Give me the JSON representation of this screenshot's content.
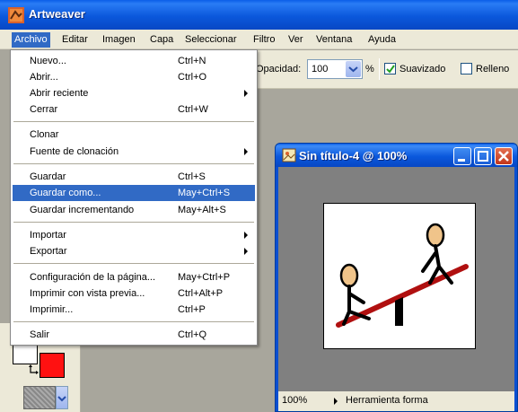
{
  "app": {
    "title": "Artweaver"
  },
  "menubar": {
    "items": [
      "Archivo",
      "Editar",
      "Imagen",
      "Capa",
      "Seleccionar",
      "Filtro",
      "Ver",
      "Ventana",
      "Ayuda"
    ],
    "active": "Archivo"
  },
  "options": {
    "opacity_label": "Opacidad:",
    "opacity_value": "100",
    "percent": "%",
    "smoothing_label": "Suavizado",
    "smoothing_checked": true,
    "fill_label": "Relleno",
    "fill_checked": false
  },
  "file_menu": [
    {
      "label": "Nuevo...",
      "shortcut": "Ctrl+N"
    },
    {
      "label": "Abrir...",
      "shortcut": "Ctrl+O"
    },
    {
      "label": "Abrir reciente",
      "shortcut": "",
      "submenu": true
    },
    {
      "label": "Cerrar",
      "shortcut": "Ctrl+W"
    },
    {
      "label": "Clonar",
      "shortcut": ""
    },
    {
      "label": "Fuente de clonación",
      "shortcut": "",
      "submenu": true
    },
    {
      "label": "Guardar",
      "shortcut": "Ctrl+S"
    },
    {
      "label": "Guardar como...",
      "shortcut": "May+Ctrl+S",
      "highlighted": true
    },
    {
      "label": "Guardar incrementando",
      "shortcut": "May+Alt+S"
    },
    {
      "label": "Importar",
      "shortcut": "",
      "submenu": true
    },
    {
      "label": "Exportar",
      "shortcut": "",
      "submenu": true
    },
    {
      "label": "Configuración de la página...",
      "shortcut": "May+Ctrl+P"
    },
    {
      "label": "Imprimir con vista previa...",
      "shortcut": "Ctrl+Alt+P"
    },
    {
      "label": "Imprimir...",
      "shortcut": "Ctrl+P"
    },
    {
      "label": "Salir",
      "shortcut": "Ctrl+Q"
    }
  ],
  "document": {
    "title": "Sin título-4 @ 100%",
    "zoom": "100%",
    "tool": "Herramienta forma"
  },
  "colors": {
    "foreground": "#ffffff",
    "background": "#ff1111",
    "menu_highlight": "#316ac5",
    "seesaw": "#b01010"
  }
}
